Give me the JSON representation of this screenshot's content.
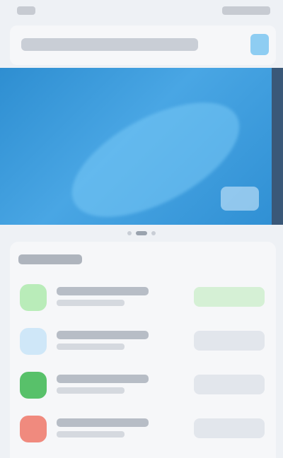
{
  "colors": {
    "accent_blue": "#2e8ed1",
    "banner_strip": "#3a5878",
    "icon_green_light": "#b9ecb9",
    "icon_blue_light": "#cfe7f8",
    "icon_green": "#58c16a",
    "icon_red": "#f08a7e",
    "action_primary": "#d5f0d5"
  },
  "status_bar": {
    "time": "",
    "icons": ""
  },
  "header": {
    "title": "",
    "action_icon": "search-icon"
  },
  "banner": {
    "caption": "",
    "logo_icon": "logo-icon"
  },
  "pager": {
    "count": 3,
    "active_index": 1
  },
  "section": {
    "title": "",
    "items": [
      {
        "icon": "app-icon",
        "title": "",
        "subtitle": "",
        "action": ""
      },
      {
        "icon": "app-icon",
        "title": "",
        "subtitle": "",
        "action": ""
      },
      {
        "icon": "app-icon",
        "title": "",
        "subtitle": "",
        "action": ""
      },
      {
        "icon": "app-icon",
        "title": "",
        "subtitle": "",
        "action": ""
      }
    ]
  }
}
